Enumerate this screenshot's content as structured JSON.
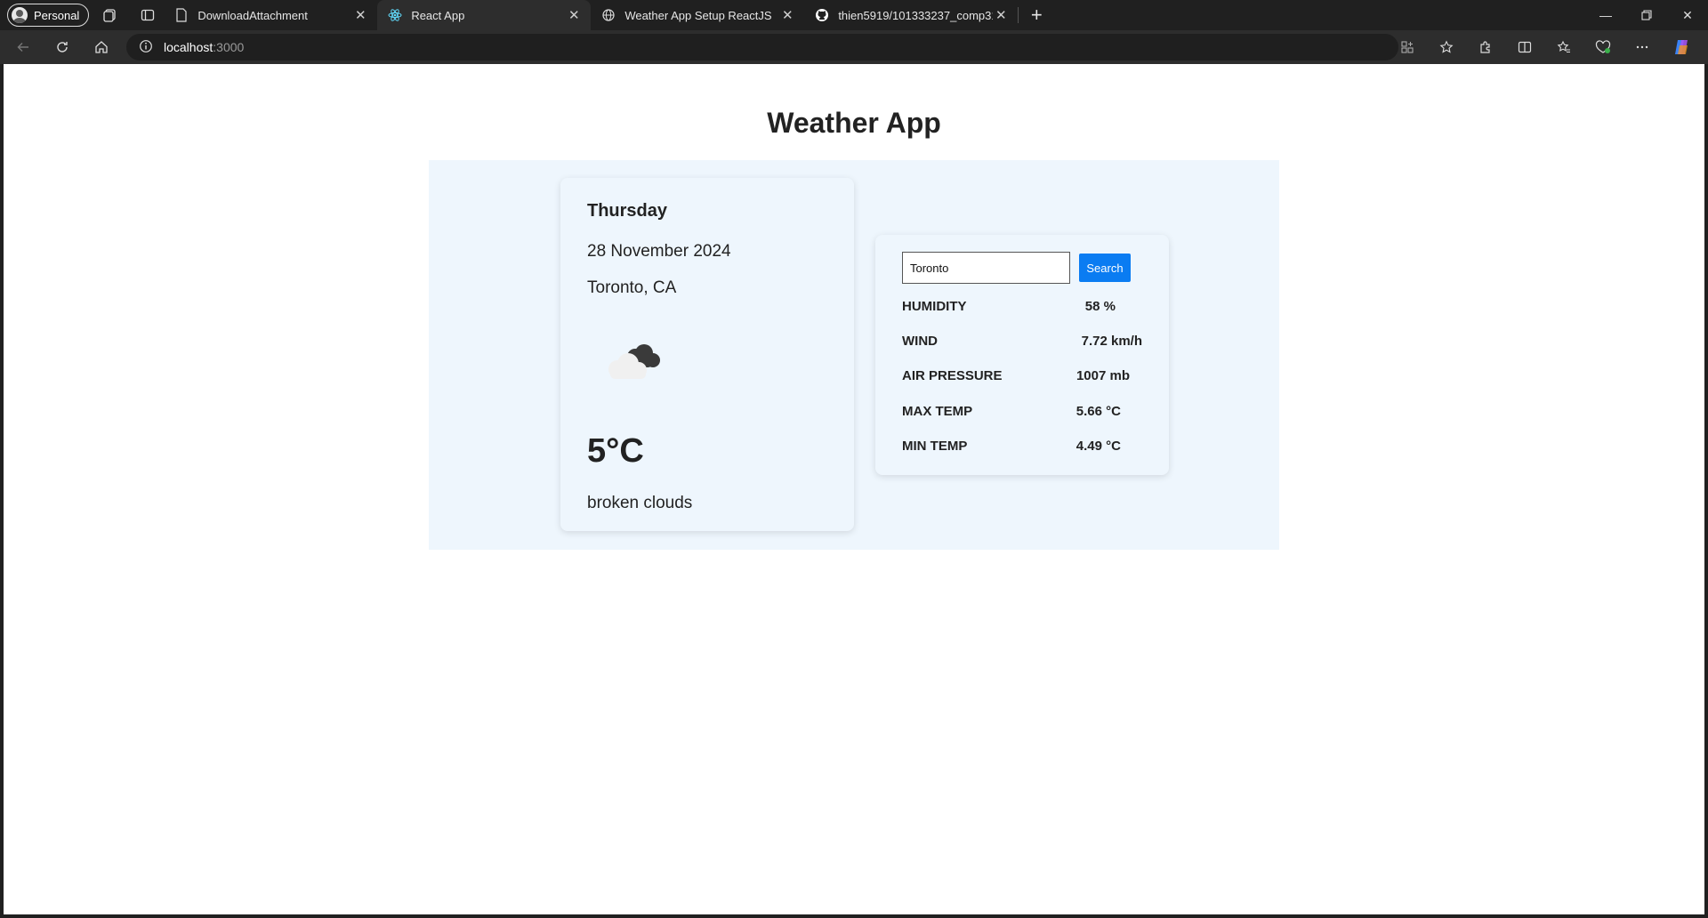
{
  "browser": {
    "profile_label": "Personal",
    "tabs": [
      {
        "label": "DownloadAttachment",
        "icon": "document-icon"
      },
      {
        "label": "React App",
        "icon": "react-icon"
      },
      {
        "label": "Weather App Setup ReactJS",
        "icon": "globe-icon"
      },
      {
        "label": "thien5919/101333237_comp3123",
        "icon": "github-icon"
      }
    ],
    "active_tab": 1,
    "address": {
      "host": "localhost",
      "port": ":3000"
    },
    "colors": {
      "chrome_dark": "#202020",
      "toolbar": "#2d2d2d"
    }
  },
  "page": {
    "title": "Weather App"
  },
  "weather": {
    "day": "Thursday",
    "date": "28 November 2024",
    "location": "Toronto, CA",
    "icon": "broken-clouds-icon",
    "temperature": "5°C",
    "description": "broken clouds"
  },
  "search": {
    "value": "Toronto",
    "button_label": "Search"
  },
  "stats": [
    {
      "label": "HUMIDITY",
      "value": "58 %"
    },
    {
      "label": "WIND",
      "value": "7.72 km/h"
    },
    {
      "label": "AIR PRESSURE",
      "value": "1007 mb"
    },
    {
      "label": "MAX TEMP",
      "value": "5.66 °C"
    },
    {
      "label": "MIN TEMP",
      "value": "4.49 °C"
    }
  ],
  "colors": {
    "panel_bg": "#eef6fd",
    "accent": "#0a7cf2"
  }
}
